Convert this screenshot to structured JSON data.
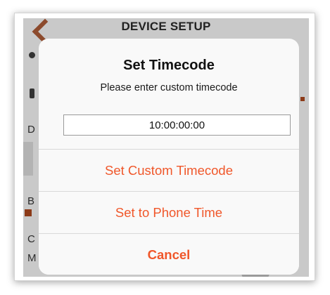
{
  "nav": {
    "title": "DEVICE SETUP"
  },
  "background_rows": [
    {
      "letter": "D"
    },
    {
      "letter": "B"
    },
    {
      "letter": "C"
    },
    {
      "letter": "M"
    }
  ],
  "alert": {
    "title": "Set Timecode",
    "message": "Please enter custom timecode",
    "input_value": "10:00:00:00",
    "actions": {
      "set_custom": "Set Custom Timecode",
      "set_phone": "Set to Phone Time",
      "cancel": "Cancel"
    }
  },
  "colors": {
    "accent": "#f0572a",
    "dim_background": "#c9c9c9",
    "alert_background": "#f9f9f9"
  }
}
